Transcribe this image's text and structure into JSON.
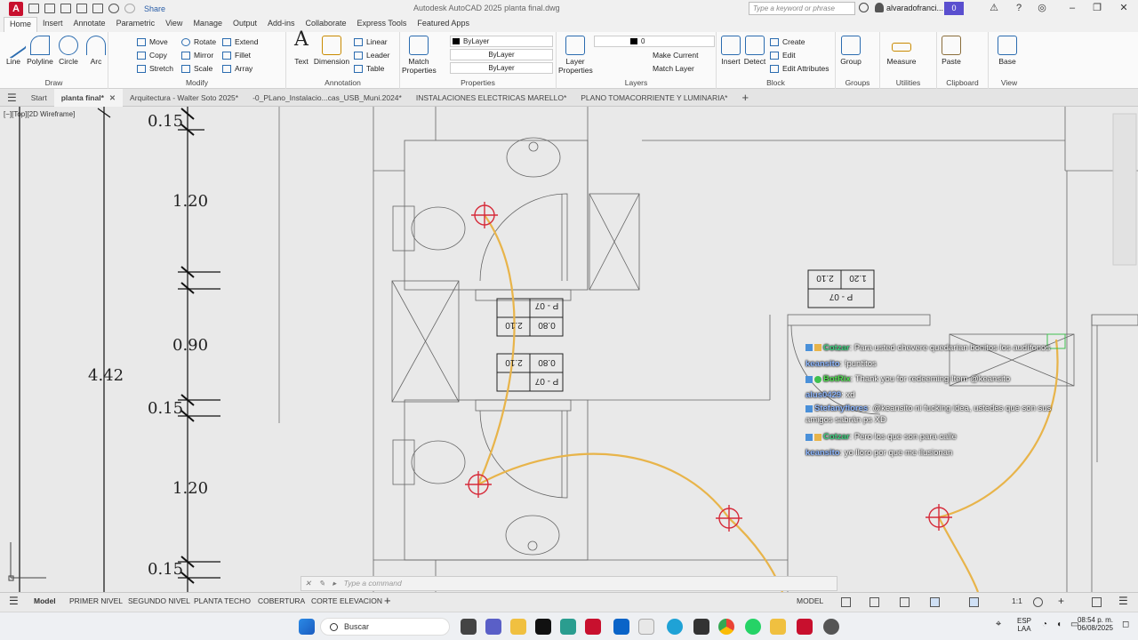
{
  "titlebar": {
    "share_label": "Share",
    "app_title": "Autodesk AutoCAD 2025   planta final.dwg",
    "search_placeholder": "Type a keyword or phrase",
    "user_name": "alvaradofranci...",
    "notif_count": "0",
    "app_letter": "A"
  },
  "ribbon_tabs": [
    "Home",
    "Insert",
    "Annotate",
    "Parametric",
    "View",
    "Manage",
    "Output",
    "Add-ins",
    "Collaborate",
    "Express Tools",
    "Featured Apps"
  ],
  "ribbon": {
    "draw": {
      "title": "Draw",
      "tools": [
        "Line",
        "Polyline",
        "Circle",
        "Arc"
      ]
    },
    "modify": {
      "title": "Modify",
      "tools": [
        "Move",
        "Rotate",
        "Extend",
        "Copy",
        "Mirror",
        "Fillet",
        "Stretch",
        "Scale",
        "Array"
      ]
    },
    "annotation": {
      "title": "Annotation",
      "big": [
        "Text",
        "Dimension"
      ],
      "tools": [
        "Linear",
        "Leader",
        "Table"
      ]
    },
    "properties": {
      "title": "Properties",
      "match": "Match Properties",
      "color": "ByLayer",
      "linetype": "ByLayer",
      "lineweight": "ByLayer"
    },
    "layers": {
      "title": "Layers",
      "props": "Layer Properties",
      "current_layer": "0",
      "tools": [
        "Make Current",
        "Match Layer"
      ]
    },
    "block": {
      "title": "Block",
      "big": [
        "Insert",
        "Detect"
      ],
      "tools": [
        "Create",
        "Edit",
        "Edit Attributes"
      ]
    },
    "groups": {
      "title": "Groups",
      "big": "Group"
    },
    "utilities": {
      "title": "Utilities",
      "big": "Measure"
    },
    "clipboard": {
      "title": "Clipboard",
      "big": "Paste"
    },
    "view": {
      "title": "View",
      "big": "Base"
    }
  },
  "doc_tabs": [
    {
      "label": "Start",
      "active": false
    },
    {
      "label": "planta final*",
      "active": true
    },
    {
      "label": "Arquitectura - Walter Soto 2025*",
      "active": false
    },
    {
      "label": "-0_PLano_Instalacio...cas_USB_Muni.2024*",
      "active": false
    },
    {
      "label": "INSTALACIONES ELECTRICAS MARELLO*",
      "active": false
    },
    {
      "label": "PLANO TOMACORRIENTE Y LUMINARIA*",
      "active": false
    }
  ],
  "viewport_label": "[−][Top][2D Wireframe]",
  "dimensions": {
    "d1": "0.15",
    "d2": "1.20",
    "d3": "0.90",
    "d4": "0.15",
    "d5": "1.20",
    "d6": "0.15",
    "total": "4.42"
  },
  "door_tags": [
    {
      "code": "P - 07",
      "w": "0.80",
      "h": "2.10"
    },
    {
      "code": "P - 07",
      "w": "0.80",
      "h": "2.10"
    },
    {
      "code": "P - 07",
      "w": "1.20",
      "h": "2.10"
    }
  ],
  "chat": [
    {
      "user": "Cotzar",
      "text": ": Para usted chevere quedarían bonitos los audífonos",
      "color": "#3fd07f"
    },
    {
      "user": "keansito",
      "text": ": !puntitos",
      "color": "#8fb8ff"
    },
    {
      "user": "BotRix",
      "text": ": Thank you for redeeming Item @keansito",
      "color": "#4ee04e"
    },
    {
      "user": "alus0429",
      "text": ": xd",
      "color": "#8fb8ff"
    },
    {
      "user": "Stefanyflores",
      "text": ": @keansito ni fucking idea, ustedes que son sus amigos sabrán ps XD",
      "color": "#8fb8ff"
    },
    {
      "user": "Cotzar",
      "text": ": Pero los que son para calle",
      "color": "#3fd07f"
    },
    {
      "user": "keansito",
      "text": ": yo lloro por que me ilusionan",
      "color": "#8fb8ff"
    }
  ],
  "command": {
    "placeholder": "Type a command"
  },
  "layout_tabs": [
    "Model",
    "PRIMER NIVEL",
    "SEGUNDO NIVEL",
    "PLANTA TECHO",
    "COBERTURA",
    "CORTE ELEVACION"
  ],
  "status": {
    "model": "MODEL",
    "scale": "1:1"
  },
  "taskbar": {
    "search": "Buscar",
    "lang1": "ESP",
    "lang2": "LAA",
    "time": "08:54 p. m.",
    "date": "06/08/2025"
  },
  "colors": {
    "accent": "#2b6cb0",
    "wire": "#e8b44a",
    "outlet": "#d62b3a",
    "autocad_red": "#c8102e"
  }
}
